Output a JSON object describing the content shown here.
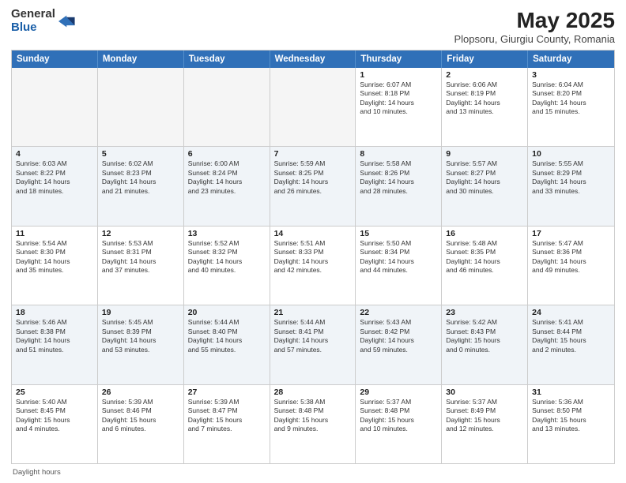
{
  "logo": {
    "general": "General",
    "blue": "Blue"
  },
  "title": "May 2025",
  "subtitle": "Plopsoru, Giurgiu County, Romania",
  "days_of_week": [
    "Sunday",
    "Monday",
    "Tuesday",
    "Wednesday",
    "Thursday",
    "Friday",
    "Saturday"
  ],
  "footer_text": "Daylight hours",
  "weeks": [
    [
      {
        "day": "",
        "info": "",
        "empty": true
      },
      {
        "day": "",
        "info": "",
        "empty": true
      },
      {
        "day": "",
        "info": "",
        "empty": true
      },
      {
        "day": "",
        "info": "",
        "empty": true
      },
      {
        "day": "1",
        "info": "Sunrise: 6:07 AM\nSunset: 8:18 PM\nDaylight: 14 hours\nand 10 minutes.",
        "empty": false
      },
      {
        "day": "2",
        "info": "Sunrise: 6:06 AM\nSunset: 8:19 PM\nDaylight: 14 hours\nand 13 minutes.",
        "empty": false
      },
      {
        "day": "3",
        "info": "Sunrise: 6:04 AM\nSunset: 8:20 PM\nDaylight: 14 hours\nand 15 minutes.",
        "empty": false
      }
    ],
    [
      {
        "day": "4",
        "info": "Sunrise: 6:03 AM\nSunset: 8:22 PM\nDaylight: 14 hours\nand 18 minutes.",
        "empty": false
      },
      {
        "day": "5",
        "info": "Sunrise: 6:02 AM\nSunset: 8:23 PM\nDaylight: 14 hours\nand 21 minutes.",
        "empty": false
      },
      {
        "day": "6",
        "info": "Sunrise: 6:00 AM\nSunset: 8:24 PM\nDaylight: 14 hours\nand 23 minutes.",
        "empty": false
      },
      {
        "day": "7",
        "info": "Sunrise: 5:59 AM\nSunset: 8:25 PM\nDaylight: 14 hours\nand 26 minutes.",
        "empty": false
      },
      {
        "day": "8",
        "info": "Sunrise: 5:58 AM\nSunset: 8:26 PM\nDaylight: 14 hours\nand 28 minutes.",
        "empty": false
      },
      {
        "day": "9",
        "info": "Sunrise: 5:57 AM\nSunset: 8:27 PM\nDaylight: 14 hours\nand 30 minutes.",
        "empty": false
      },
      {
        "day": "10",
        "info": "Sunrise: 5:55 AM\nSunset: 8:29 PM\nDaylight: 14 hours\nand 33 minutes.",
        "empty": false
      }
    ],
    [
      {
        "day": "11",
        "info": "Sunrise: 5:54 AM\nSunset: 8:30 PM\nDaylight: 14 hours\nand 35 minutes.",
        "empty": false
      },
      {
        "day": "12",
        "info": "Sunrise: 5:53 AM\nSunset: 8:31 PM\nDaylight: 14 hours\nand 37 minutes.",
        "empty": false
      },
      {
        "day": "13",
        "info": "Sunrise: 5:52 AM\nSunset: 8:32 PM\nDaylight: 14 hours\nand 40 minutes.",
        "empty": false
      },
      {
        "day": "14",
        "info": "Sunrise: 5:51 AM\nSunset: 8:33 PM\nDaylight: 14 hours\nand 42 minutes.",
        "empty": false
      },
      {
        "day": "15",
        "info": "Sunrise: 5:50 AM\nSunset: 8:34 PM\nDaylight: 14 hours\nand 44 minutes.",
        "empty": false
      },
      {
        "day": "16",
        "info": "Sunrise: 5:48 AM\nSunset: 8:35 PM\nDaylight: 14 hours\nand 46 minutes.",
        "empty": false
      },
      {
        "day": "17",
        "info": "Sunrise: 5:47 AM\nSunset: 8:36 PM\nDaylight: 14 hours\nand 49 minutes.",
        "empty": false
      }
    ],
    [
      {
        "day": "18",
        "info": "Sunrise: 5:46 AM\nSunset: 8:38 PM\nDaylight: 14 hours\nand 51 minutes.",
        "empty": false
      },
      {
        "day": "19",
        "info": "Sunrise: 5:45 AM\nSunset: 8:39 PM\nDaylight: 14 hours\nand 53 minutes.",
        "empty": false
      },
      {
        "day": "20",
        "info": "Sunrise: 5:44 AM\nSunset: 8:40 PM\nDaylight: 14 hours\nand 55 minutes.",
        "empty": false
      },
      {
        "day": "21",
        "info": "Sunrise: 5:44 AM\nSunset: 8:41 PM\nDaylight: 14 hours\nand 57 minutes.",
        "empty": false
      },
      {
        "day": "22",
        "info": "Sunrise: 5:43 AM\nSunset: 8:42 PM\nDaylight: 14 hours\nand 59 minutes.",
        "empty": false
      },
      {
        "day": "23",
        "info": "Sunrise: 5:42 AM\nSunset: 8:43 PM\nDaylight: 15 hours\nand 0 minutes.",
        "empty": false
      },
      {
        "day": "24",
        "info": "Sunrise: 5:41 AM\nSunset: 8:44 PM\nDaylight: 15 hours\nand 2 minutes.",
        "empty": false
      }
    ],
    [
      {
        "day": "25",
        "info": "Sunrise: 5:40 AM\nSunset: 8:45 PM\nDaylight: 15 hours\nand 4 minutes.",
        "empty": false
      },
      {
        "day": "26",
        "info": "Sunrise: 5:39 AM\nSunset: 8:46 PM\nDaylight: 15 hours\nand 6 minutes.",
        "empty": false
      },
      {
        "day": "27",
        "info": "Sunrise: 5:39 AM\nSunset: 8:47 PM\nDaylight: 15 hours\nand 7 minutes.",
        "empty": false
      },
      {
        "day": "28",
        "info": "Sunrise: 5:38 AM\nSunset: 8:48 PM\nDaylight: 15 hours\nand 9 minutes.",
        "empty": false
      },
      {
        "day": "29",
        "info": "Sunrise: 5:37 AM\nSunset: 8:48 PM\nDaylight: 15 hours\nand 10 minutes.",
        "empty": false
      },
      {
        "day": "30",
        "info": "Sunrise: 5:37 AM\nSunset: 8:49 PM\nDaylight: 15 hours\nand 12 minutes.",
        "empty": false
      },
      {
        "day": "31",
        "info": "Sunrise: 5:36 AM\nSunset: 8:50 PM\nDaylight: 15 hours\nand 13 minutes.",
        "empty": false
      }
    ]
  ]
}
